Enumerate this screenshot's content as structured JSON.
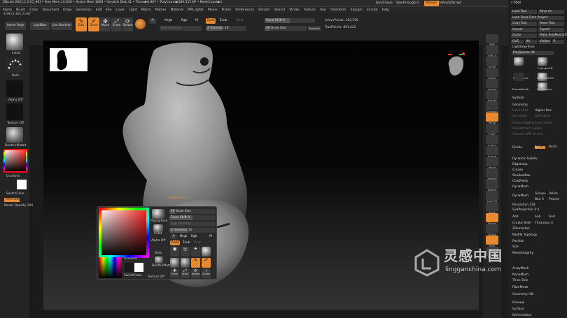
{
  "titlebar": {
    "title": "ZBrush 2021.1.5 [Q_96]  • Free Mem 14.950 • Active Mem 1663 • Scratch Disk 41 • Timer▶0.967 • PolyCount▶589.515 KP • MeshCount▶1",
    "coords": "-1.995,4.303,-4.347",
    "quicksave": "QuickSave",
    "seethrough": "See-through 0",
    "menus": "Menus",
    "script": "DefaultZScript"
  },
  "menubar": [
    "Alpha",
    "Brush",
    "Color",
    "Document",
    "Draw",
    "Dynamics",
    "Edit",
    "File",
    "Layer",
    "Light",
    "Macro",
    "Marker",
    "Material",
    "MM_lights",
    "Movie",
    "Picker",
    "Preferences",
    "Render",
    "Stencil",
    "Stroke",
    "Texture",
    "Tool",
    "Transform",
    "Zplugin",
    "Zscript",
    "Help"
  ],
  "toolbar": {
    "home": "Home Page",
    "lightbox": "LightBox",
    "livebool": "Live Boolean",
    "edit": "Edit",
    "draw": "Draw",
    "move": "Move",
    "scale": "Scale",
    "rotate": "Rotate",
    "a": "A",
    "mrgb": "Mrgb",
    "rgb": "Rgb",
    "m": "M",
    "rgb_intensity": "Rgb Intensity",
    "zadd": "Zadd",
    "zsub": "Zsub",
    "zcut": "Zcut",
    "z_intensity": "Z Intensity 10",
    "z_intensity_value": 0.4,
    "focal": "Focal Shift 0",
    "focal_value": 0.5,
    "drawsize": "49 Draw Size",
    "drawsize_value": 0.12,
    "dynamic": "Dynamic",
    "active_points": "ActivePoints: 582,558",
    "total_points": "TotalPoints: 891,425"
  },
  "leftshelf": {
    "brush": "Initial",
    "stroke": "Dots",
    "alpha": "Alpha Off",
    "texture": "Texture Off",
    "material": "DoxtturMatalt",
    "gradient": "Gradient",
    "switchcolor": "SwitchColor",
    "alternate": "Alternate",
    "opacity": "Model Opacity 100"
  },
  "canvas": {
    "gizmo_label": "head"
  },
  "rightshelf": [
    "BPR",
    "SPix 3",
    "Scroll",
    "Zoom",
    "Actual",
    "AAHalf",
    "Dynamic",
    "Persp",
    "Floor",
    "L.Sym",
    "Frame",
    "Move",
    "ZoomD",
    "Rotate",
    "Line Fill",
    "PolyF",
    "Transp",
    "Ghost",
    "Solo",
    "Xpose"
  ],
  "palette": {
    "title": "Tool",
    "buttons": [
      [
        "Load Tool",
        "Save As"
      ],
      [
        "Load Tools From Project"
      ],
      [
        "Copy Tool",
        "Paste Tool"
      ],
      [
        "Import",
        "Export"
      ],
      [
        "Clone",
        "Make PolyMesh3D"
      ],
      [
        "GoZ",
        "All",
        "Visible",
        "R"
      ]
    ],
    "lightbox_tools": "Lightbox▸Tools",
    "polysphere": "PolySphere 48",
    "tools": [
      "PolySphere",
      "Cylinder3D",
      "PolyMesh3D",
      "SimpleBrush",
      "PolySphere"
    ],
    "sections": [
      "Subtool",
      "Geometry",
      "Lower Res",
      "Higher Res",
      "Sel Lower",
      "Sel Higher",
      "Freeze SubDivision Levels",
      "Reconstruct Subdiv",
      "Convert BPR To Geo",
      "Divide",
      "Smt",
      "Suv",
      "Rsmt",
      "Dynamic Subdiv",
      "EdgeLoop",
      "Crease",
      "ShadowBox",
      "ClayPolish",
      "DynaMesh",
      "DynaMesh",
      "Groups",
      "Polish",
      "Blur 2",
      "Project",
      "Resolution 128",
      "SubProjection 0.6",
      "Add",
      "Sub",
      "And",
      "Create Shell",
      "Thickness 4",
      "ZRemesher",
      "Modify Topology",
      "Position",
      "Size",
      "MeshIntegrity",
      "ArrayMesh",
      "NanoMesh",
      "Thick Skin",
      "FiberMesh",
      "Geometry HD",
      "Preview",
      "Surface",
      "Deformation"
    ]
  },
  "popup": {
    "drawsize": "Draw Size 1",
    "drawsize_val": "49 Draw Size",
    "focal": "Focal Shift 0",
    "rgbint": "Rgb Intensity",
    "zint": "Z Intensity 10",
    "a": "A",
    "mrgb": "Mrgb",
    "rgb": "Rgb",
    "m": "M",
    "zadd": "Zadd",
    "zsub": "Zsub",
    "zcut": "Zcut",
    "polysphere": "PolySphere",
    "inflat": "Inflat",
    "alpha": "Alpha Off",
    "dots": "Dots",
    "gradient": "Gradient",
    "switchcolor": "SwitchColor",
    "material": "DoxtturMatalt",
    "texture": "Texture Off",
    "edit": "Edit",
    "draw": "Draw",
    "move": "Move",
    "scale": "Scale",
    "rotate": "Rotate",
    "stroke": "Stroke"
  },
  "watermark": {
    "chinese": "灵感中国",
    "url": "lingganchina.com"
  },
  "colors": {
    "accent": "#e8892f",
    "background": "#1b1b1b"
  }
}
